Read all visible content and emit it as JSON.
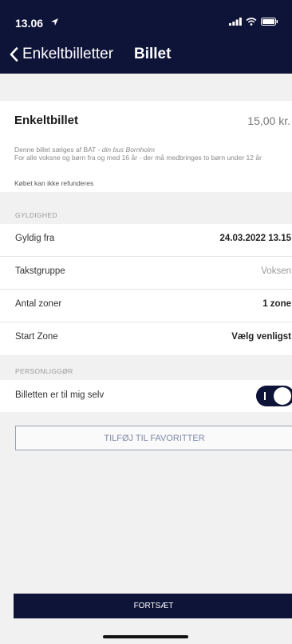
{
  "status_bar": {
    "time": "13.06",
    "icons": [
      "location-arrow-icon",
      "signal-bars-icon",
      "wifi-icon",
      "battery-icon"
    ]
  },
  "nav": {
    "back_label": "Enkeltbilletter",
    "title": "Billet"
  },
  "ticket": {
    "name": "Enkeltbillet",
    "price": "15,00 kr.",
    "desc_prefix": "Denne billet sælges af BAT - ",
    "desc_italic": "din bus Bornholm",
    "desc_rest": "For alle voksne og børn fra og med 16 år - der må medbringes to børn under 12 år",
    "note": "Købet kan ikke refunderes"
  },
  "validity": {
    "header": "GYLDIGHED",
    "rows": [
      {
        "label": "Gyldig fra",
        "value": "24.03.2022 13.15"
      },
      {
        "label": "Takstgruppe",
        "value": "Voksen"
      },
      {
        "label": "Antal zoner",
        "value": "1 zone"
      },
      {
        "label": "Start Zone",
        "value": "Vælg venligst"
      }
    ]
  },
  "personal": {
    "header": "PERSONLIGGØR",
    "toggle_label": "Billetten er til mig selv",
    "toggle_on": true
  },
  "buttons": {
    "favorite": "TILFØJ TIL FAVORITTER",
    "continue": "FORTSÆT"
  },
  "colors": {
    "primary": "#0e1338",
    "background": "#f1f1f1"
  }
}
